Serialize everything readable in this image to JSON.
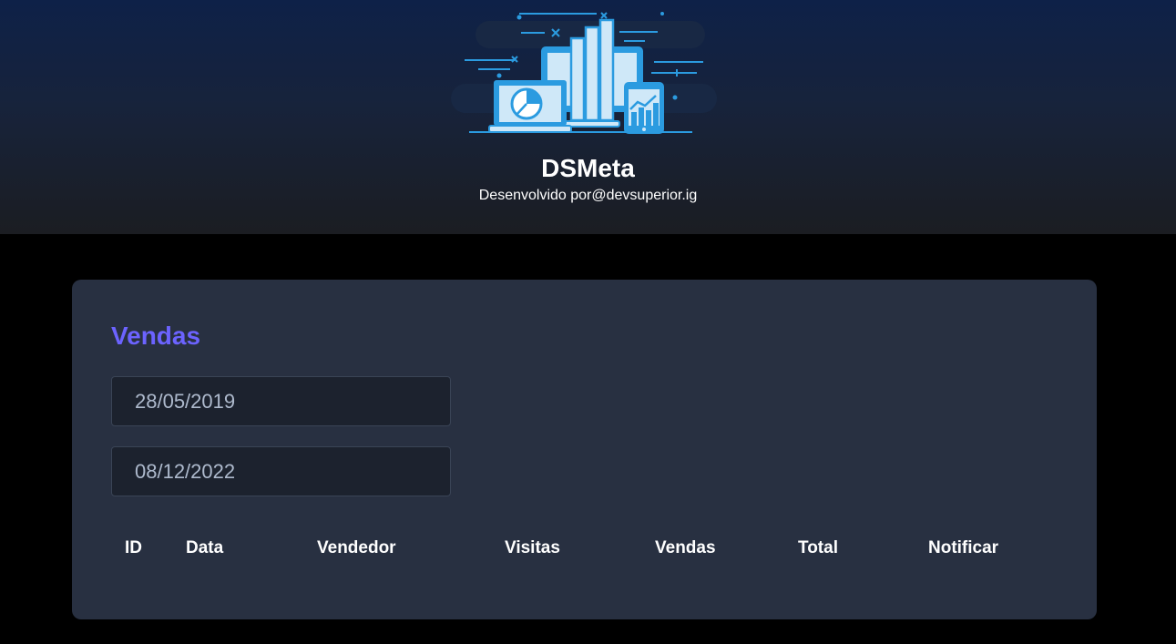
{
  "header": {
    "title": "DSMeta",
    "subtitle": "Desenvolvido por@devsuperior.ig"
  },
  "sales_card": {
    "title": "Vendas",
    "min_date": "28/05/2019",
    "max_date": "08/12/2022",
    "columns": [
      "ID",
      "Data",
      "Vendedor",
      "Visitas",
      "Vendas",
      "Total",
      "Notificar"
    ]
  },
  "colors": {
    "header_top": "#0e2148",
    "header_bottom": "#1b1d22",
    "page_background": "#000000",
    "card_background": "#283041",
    "input_background": "#1c222e",
    "accent": "#6c63ff",
    "logo_blue": "#2b9be0",
    "logo_light": "#cfe8f8"
  },
  "icons": {
    "logo": "dashboard-devices-illustration"
  }
}
